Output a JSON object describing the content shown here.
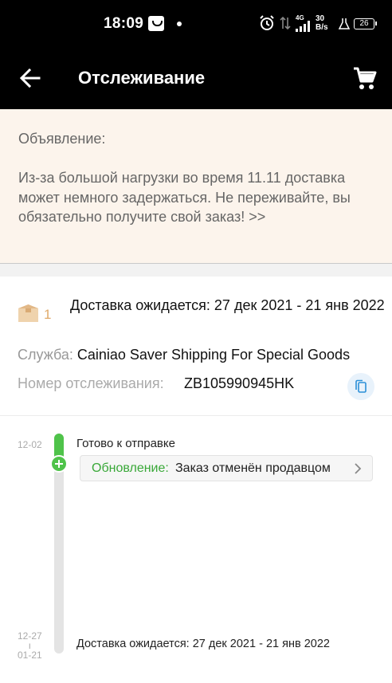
{
  "status_bar": {
    "time": "18:09",
    "network_type": "4G",
    "speed_value": "30",
    "speed_unit": "B/s",
    "battery": "26"
  },
  "app_bar": {
    "title": "Отслеживание",
    "back_icon": "arrow-left-icon",
    "cart_icon": "cart-icon"
  },
  "announcement": {
    "title": "Объявление:",
    "text": "Из-за большой нагрузки во время 11.11 доставка может немного задержаться. Не переживайте, вы обязательно получите свой заказ! >>"
  },
  "delivery": {
    "package_count": "1",
    "expected": "Доставка ожидается: 27 дек 2021 - 21 янв 2022",
    "service_label": "Служба:",
    "service_value": "Cainiao Saver Shipping For Special Goods",
    "tracking_label": "Номер отслеживания:",
    "tracking_number": "ZB105990945HK"
  },
  "timeline": {
    "events": [
      {
        "date": "12-02",
        "title": "Готово к отправке",
        "update_label": "Обновление:",
        "update_text": "Заказ отменён продавцом"
      }
    ],
    "range_start": "12-27",
    "range_sep": "ı",
    "range_end": "01-21",
    "end_text": "Доставка ожидается: 27 дек 2021 - 21 янв 2022"
  },
  "colors": {
    "accent_green": "#4fc34a",
    "announcement_bg": "#fcf4ec",
    "package_orange": "#e0aa6a",
    "copy_blue": "#2b8fd8"
  }
}
